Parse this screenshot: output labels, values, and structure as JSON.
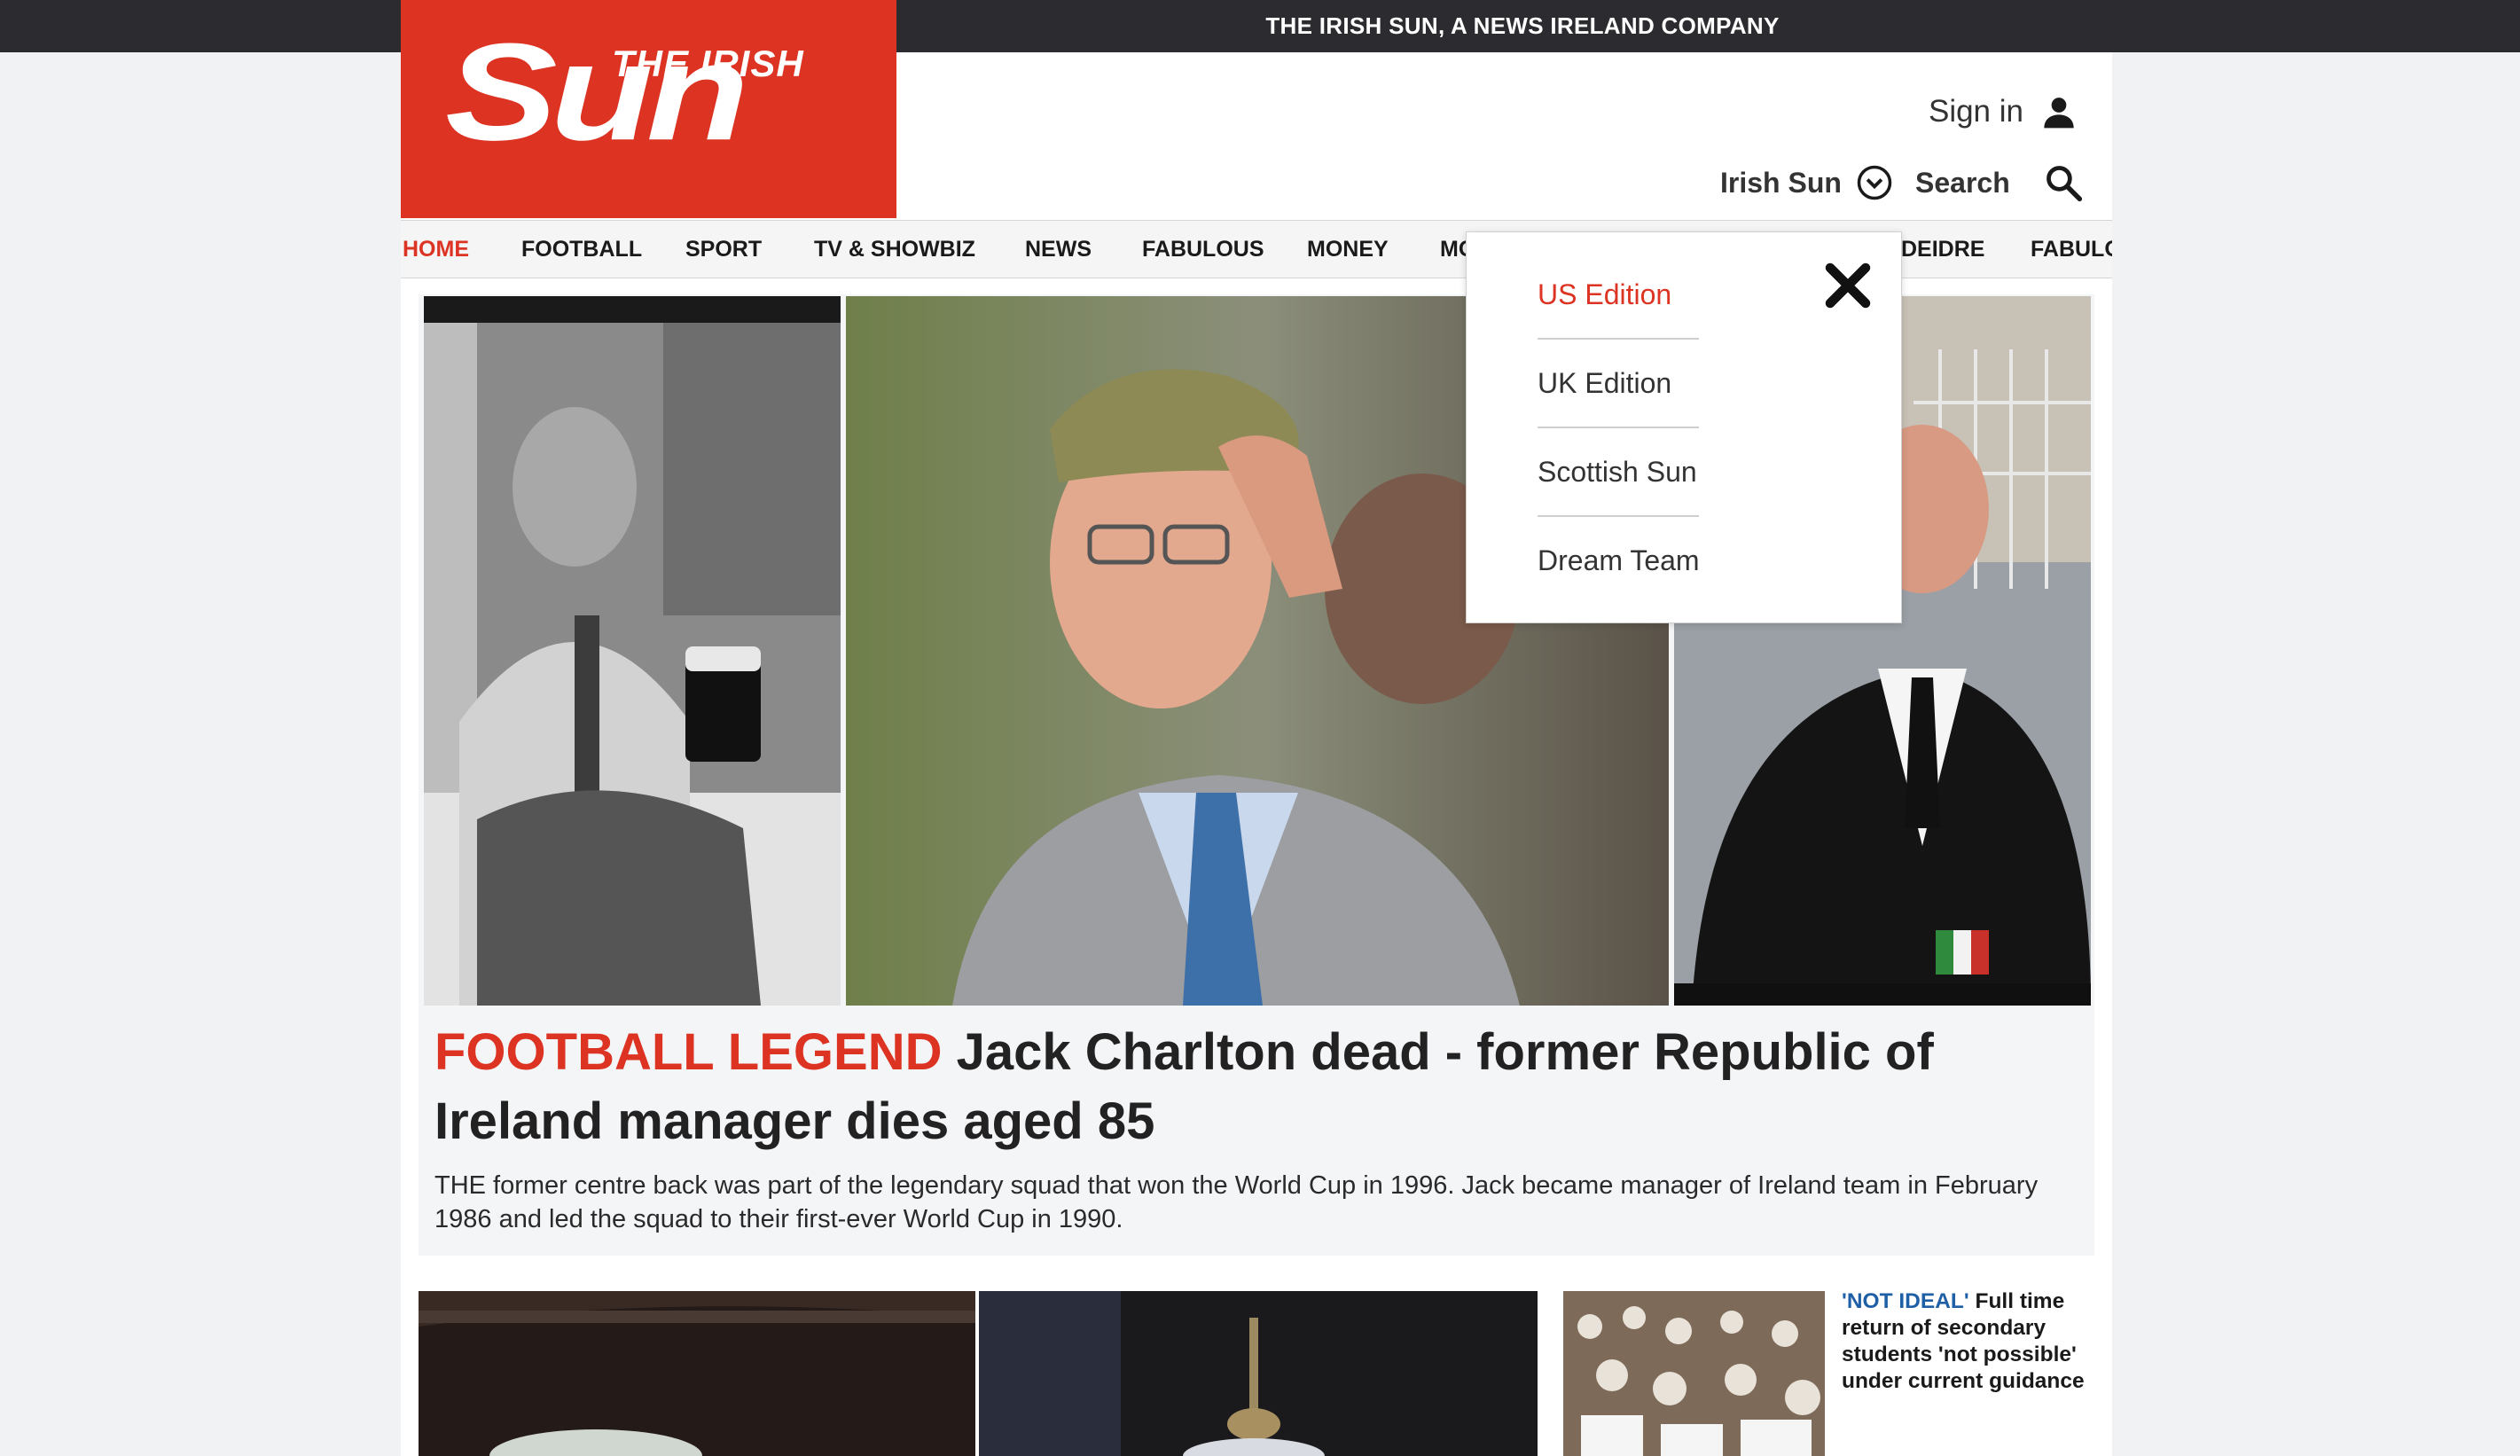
{
  "topbar": {
    "text": "THE IRISH SUN, A NEWS IRELAND COMPANY"
  },
  "logo": {
    "small_text": "THE IRISH",
    "big_text": "Sun"
  },
  "header": {
    "sign_in_label": "Sign in",
    "edition_label": "Irish Sun",
    "search_label": "Search"
  },
  "nav": {
    "items": [
      "HOME",
      "FOOTBALL",
      "SPORT",
      "TV & SHOWBIZ",
      "NEWS",
      "FABULOUS",
      "MONEY",
      "MO",
      "DEIDRE",
      "FABULO"
    ],
    "active": "HOME"
  },
  "dropdown": {
    "items": [
      "US Edition",
      "UK Edition",
      "Scottish Sun",
      "Dream Team"
    ],
    "selected": "US Edition"
  },
  "hero": {
    "kicker": "FOOTBALL LEGEND",
    "headline": " Jack Charlton dead - former Republic of Ireland manager dies aged 85",
    "standfirst": "THE former centre back was part of the legendary squad that won the World Cup in 1996. Jack became manager of Ireland team in February 1986 and led the squad to their first-ever World Cup in 1990."
  },
  "side_story": {
    "kicker": "'NOT IDEAL'",
    "headline": " Full time return of secondary students 'not possible' under current guidance"
  },
  "colors": {
    "brand_red": "#dc3322",
    "topbar": "#2c2c30",
    "side_kicker_blue": "#1f5fa6"
  }
}
